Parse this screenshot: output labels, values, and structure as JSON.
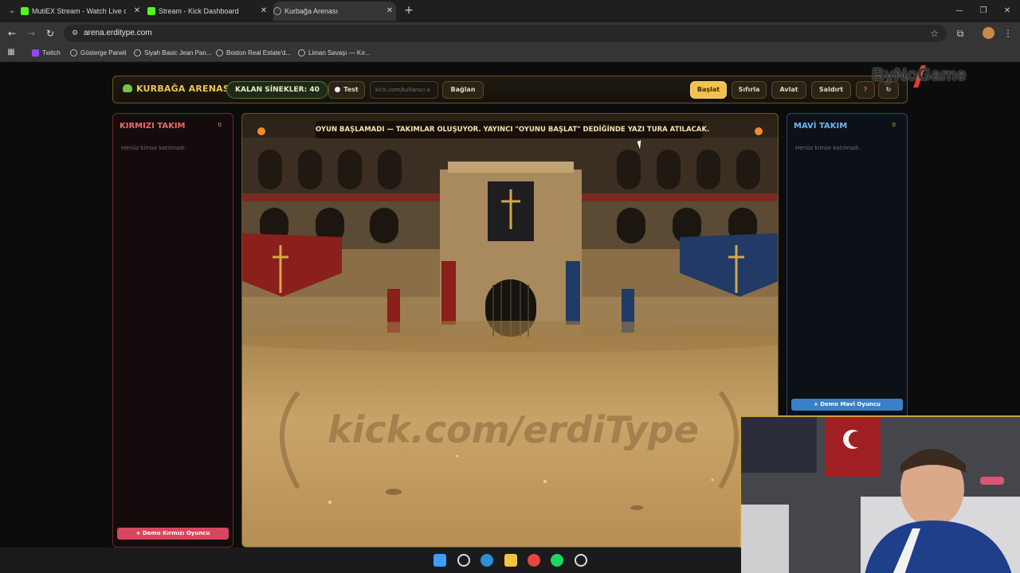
{
  "browser": {
    "tabs": [
      {
        "title": "MutiEX Stream - Watch Live on",
        "active": false
      },
      {
        "title": "Stream - Kick Dashboard",
        "active": false
      },
      {
        "title": "Kurbağa Arenası",
        "active": true
      }
    ],
    "url": "arena.erditype.com",
    "bookmarks": [
      "Twitch",
      "Gösterge Paneli",
      "Siyah Basic Jean Pan...",
      "Boston Real Estate'd...",
      "Liman Savaşı — Kır..."
    ]
  },
  "app": {
    "brand": "KURBAĞA ARENASI",
    "flies_label": "KALAN SİNEKLER: 40",
    "test_label": "Test",
    "channel_placeholder": "kick.com/kullanıcı-a",
    "connect_label": "Bağlan",
    "start_label": "Başlat",
    "reset_label": "Sıfırla",
    "hunt_label": "Avlat",
    "attack_label": "Saldırt",
    "help_label": "?",
    "refresh_label": "↻"
  },
  "teams": {
    "red": {
      "title": "KIRMIZI TAKIM",
      "count": "0",
      "empty": "Henüz kimse katılmadı.",
      "demo_button": "+ Demo Kırmızı Oyuncu"
    },
    "blue": {
      "title": "MAVİ TAKIM",
      "count": "0",
      "empty": "Henüz kimse katılmadı.",
      "demo_button": "+ Demo Mavi Oyuncu"
    }
  },
  "arena": {
    "status_banner": "OYUN BAŞLAMADI — TAKIMLAR OLUŞUYOR. YAYINCI \"OYUNU BAŞLAT\" DEDİĞİNDE YAZI TURA ATILACAK.",
    "watermark": "kick.com/erdiType"
  },
  "overlay": {
    "logo_text": "ByNoGame"
  },
  "colors": {
    "accent_gold": "#f2c24e",
    "red_team": "#d5475e",
    "blue_team": "#3b80c6"
  }
}
